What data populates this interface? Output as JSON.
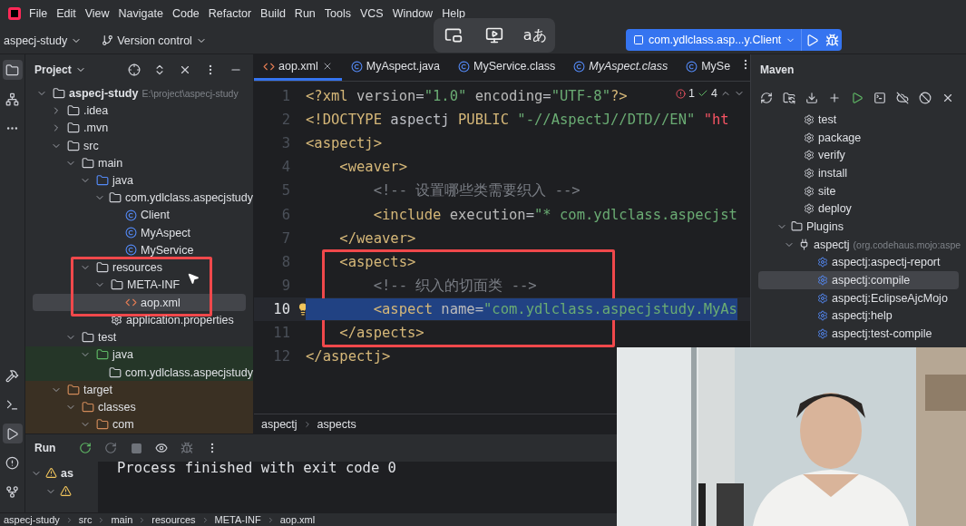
{
  "menu": [
    "File",
    "Edit",
    "View",
    "Navigate",
    "Code",
    "Refactor",
    "Build",
    "Run",
    "Tools",
    "VCS",
    "Window",
    "Help"
  ],
  "toolbar": {
    "project": "aspecj-study",
    "vcs": "Version control",
    "overlay_text": "aあ",
    "run_config": "com.ydlclass.asp...y.Client"
  },
  "project_panel": {
    "title": "Project",
    "tree": [
      {
        "label": "aspecj-study",
        "kind": "module",
        "path": "E:\\project\\aspecj-study",
        "expanded": true,
        "children": [
          {
            "label": ".idea",
            "kind": "folder",
            "expanded": false
          },
          {
            "label": ".mvn",
            "kind": "folder",
            "expanded": false
          },
          {
            "label": "src",
            "kind": "folder",
            "expanded": true,
            "children": [
              {
                "label": "main",
                "kind": "folder",
                "expanded": true,
                "children": [
                  {
                    "label": "java",
                    "kind": "source",
                    "expanded": true,
                    "children": [
                      {
                        "label": "com.ydlclass.aspecjstudy",
                        "kind": "package",
                        "expanded": true,
                        "children": [
                          {
                            "label": "Client",
                            "kind": "class"
                          },
                          {
                            "label": "MyAspect",
                            "kind": "class"
                          },
                          {
                            "label": "MyService",
                            "kind": "class"
                          }
                        ]
                      }
                    ]
                  },
                  {
                    "label": "resources",
                    "kind": "resources",
                    "expanded": true,
                    "children": [
                      {
                        "label": "META-INF",
                        "kind": "folder",
                        "expanded": true,
                        "children": [
                          {
                            "label": "aop.xml",
                            "kind": "xml",
                            "selected": true
                          }
                        ]
                      },
                      {
                        "label": "application.properties",
                        "kind": "properties",
                        "selected": false
                      }
                    ]
                  }
                ]
              },
              {
                "label": "test",
                "kind": "folder",
                "expanded": true,
                "children": [
                  {
                    "label": "java",
                    "kind": "test_source",
                    "expanded": true,
                    "children": [
                      {
                        "label": "com.ydlclass.aspecjstudy",
                        "kind": "test_package"
                      }
                    ]
                  }
                ]
              }
            ]
          },
          {
            "label": "target",
            "kind": "excluded",
            "expanded": true,
            "children": [
              {
                "label": "classes",
                "kind": "excluded",
                "expanded": true,
                "children": [
                  {
                    "label": "com",
                    "kind": "excluded",
                    "expanded": true
                  }
                ]
              }
            ]
          }
        ]
      }
    ]
  },
  "editor": {
    "tabs": [
      {
        "label": "aop.xml",
        "kind": "xml",
        "selected": true,
        "italic": false
      },
      {
        "label": "MyAspect.java",
        "kind": "class",
        "selected": false,
        "italic": false
      },
      {
        "label": "MyService.class",
        "kind": "class",
        "selected": false,
        "italic": false
      },
      {
        "label": "MyAspect.class",
        "kind": "class",
        "selected": false,
        "italic": true
      },
      {
        "label": "MySe",
        "kind": "class",
        "selected": false,
        "italic": false
      }
    ],
    "inspections": {
      "errors": "1",
      "warnings": "4"
    },
    "lines": [
      {
        "number": "1",
        "current": false,
        "selected": false,
        "tokens": [
          {
            "kind": "tag",
            "text": "<?xml"
          },
          {
            "kind": "attr",
            "text": " version"
          },
          {
            "kind": "plain",
            "text": "="
          },
          {
            "kind": "string",
            "text": "\"1.0\""
          },
          {
            "kind": "attr",
            "text": " encoding"
          },
          {
            "kind": "plain",
            "text": "="
          },
          {
            "kind": "string",
            "text": "\"UTF-8\""
          },
          {
            "kind": "tag",
            "text": "?>"
          }
        ]
      },
      {
        "number": "2",
        "current": false,
        "selected": false,
        "tokens": [
          {
            "kind": "tag",
            "text": "<!DOCTYPE"
          },
          {
            "kind": "plain",
            "text": " aspectj "
          },
          {
            "kind": "tag",
            "text": "PUBLIC"
          },
          {
            "kind": "string",
            "text": " \"-//AspectJ//DTD//EN\""
          },
          {
            "kind": "url",
            "text": " \"ht"
          }
        ]
      },
      {
        "number": "3",
        "current": false,
        "selected": false,
        "tokens": [
          {
            "kind": "tag",
            "text": "<aspectj>"
          }
        ]
      },
      {
        "number": "4",
        "current": false,
        "selected": false,
        "tokens": [
          {
            "kind": "tag",
            "text": "    <weaver>"
          }
        ]
      },
      {
        "number": "5",
        "current": false,
        "selected": false,
        "tokens": [
          {
            "kind": "comment",
            "text": "        <!-- 设置哪些类需要织入 -->"
          }
        ]
      },
      {
        "number": "6",
        "current": false,
        "selected": false,
        "tokens": [
          {
            "kind": "tag",
            "text": "        <include"
          },
          {
            "kind": "attr",
            "text": " execution"
          },
          {
            "kind": "plain",
            "text": "="
          },
          {
            "kind": "string",
            "text": "\"* com.ydlclass.aspecjst"
          }
        ]
      },
      {
        "number": "7",
        "current": false,
        "selected": false,
        "tokens": [
          {
            "kind": "tag",
            "text": "    </weaver>"
          }
        ]
      },
      {
        "number": "8",
        "current": false,
        "selected": false,
        "tokens": [
          {
            "kind": "tag",
            "text": "    <aspects>"
          }
        ]
      },
      {
        "number": "9",
        "current": false,
        "selected": false,
        "tokens": [
          {
            "kind": "comment",
            "text": "        <!-- 织入的切面类 -->"
          }
        ]
      },
      {
        "number": "10",
        "current": true,
        "selected": true,
        "bulb": true,
        "tokens": [
          {
            "kind": "tag",
            "text": "        <aspect"
          },
          {
            "kind": "attr",
            "text": " name"
          },
          {
            "kind": "plain",
            "text": "="
          },
          {
            "kind": "string",
            "text": "\"com.ydlclass.aspecjstudy.MyAs"
          }
        ]
      },
      {
        "number": "11",
        "current": false,
        "selected": false,
        "tokens": [
          {
            "kind": "tag",
            "text": "    </aspects>"
          }
        ]
      },
      {
        "number": "12",
        "current": false,
        "selected": false,
        "tokens": [
          {
            "kind": "tag",
            "text": "</aspectj>"
          }
        ]
      }
    ],
    "breadcrumb": [
      "aspectj",
      "aspects"
    ]
  },
  "maven": {
    "title": "Maven",
    "lifecycle": [
      "test",
      "package",
      "verify",
      "install",
      "site",
      "deploy"
    ],
    "plugins": {
      "label": "Plugins",
      "expanded": true,
      "children": [
        {
          "label": "aspectj",
          "detail": "(org.codehaus.mojo:aspe",
          "expanded": true,
          "goals": [
            {
              "label": "aspectj:aspectj-report",
              "selected": false
            },
            {
              "label": "aspectj:compile",
              "selected": true
            },
            {
              "label": "aspectj:EclipseAjcMojo",
              "selected": false
            },
            {
              "label": "aspectj:help",
              "selected": false
            },
            {
              "label": "aspectj:test-compile",
              "selected": false
            }
          ]
        }
      ]
    }
  },
  "run_panel": {
    "title": "Run",
    "tree": [
      {
        "label": "as",
        "expanded": true
      },
      {
        "expanded": true
      }
    ],
    "output": "Process finished with exit code 0"
  },
  "status_bar": [
    "aspecj-study",
    "src",
    "main",
    "resources",
    "META-INF",
    "aop.xml"
  ]
}
